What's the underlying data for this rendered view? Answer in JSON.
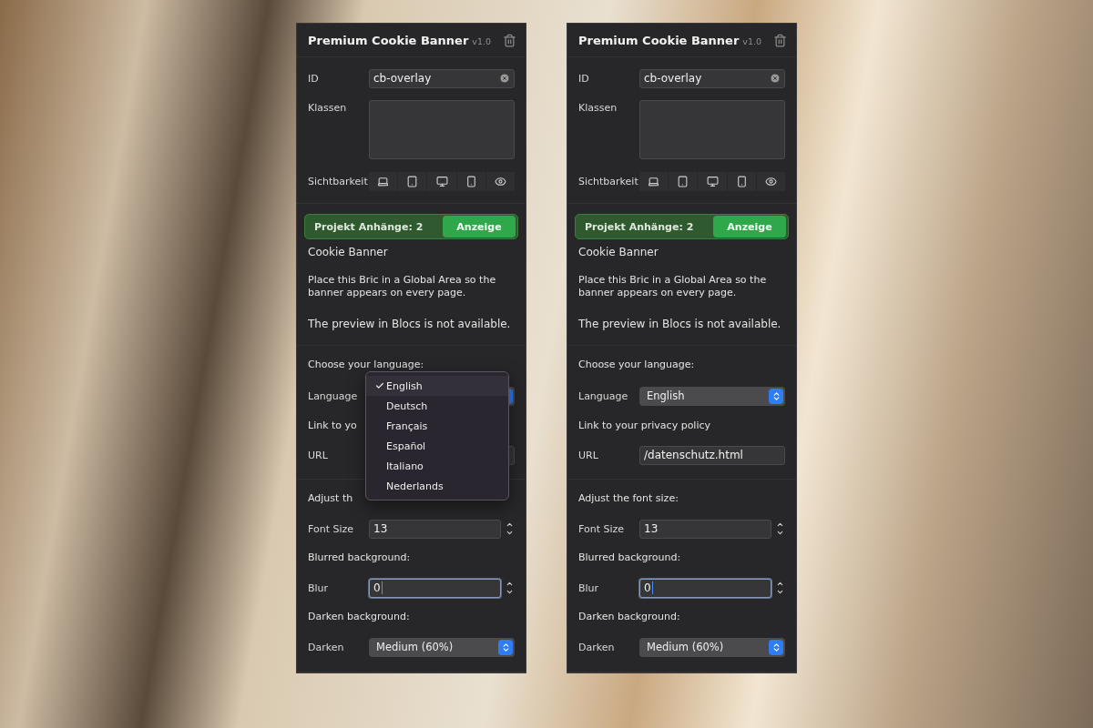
{
  "panels": [
    {
      "title": "Premium Cookie Banner",
      "version": "v1.0",
      "id_label": "ID",
      "id_value": "cb-overlay",
      "classes_label": "Klassen",
      "visibility_label": "Sichtbarkeit",
      "attachments_label": "Projekt Anhänge: 2",
      "attachments_button": "Anzeige",
      "bric_name": "Cookie Banner",
      "description": "Place this Bric in a Global Area so the banner appears on every page.",
      "preview_note": "The preview in Blocs is not available.",
      "language_heading": "Choose your language:",
      "language_label": "Language",
      "link_heading": "Link to yo",
      "url_label": "URL",
      "font_heading": "Adjust th",
      "font_label": "Font Size",
      "font_value": "13",
      "blur_heading": "Blurred background:",
      "blur_label": "Blur",
      "blur_value": "0",
      "blur_focused": true,
      "darken_heading": "Darken background:",
      "darken_label": "Darken",
      "darken_value": "Medium (60%)",
      "language_menu": {
        "options": [
          {
            "label": "English",
            "selected": true
          },
          {
            "label": "Deutsch",
            "selected": false
          },
          {
            "label": "Français",
            "selected": false
          },
          {
            "label": "Español",
            "selected": false
          },
          {
            "label": "Italiano",
            "selected": false
          },
          {
            "label": "Nederlands",
            "selected": false
          }
        ]
      }
    },
    {
      "title": "Premium Cookie Banner",
      "version": "v1.0",
      "id_label": "ID",
      "id_value": "cb-overlay",
      "classes_label": "Klassen",
      "visibility_label": "Sichtbarkeit",
      "attachments_label": "Projekt Anhänge: 2",
      "attachments_button": "Anzeige",
      "bric_name": "Cookie Banner",
      "description": "Place this Bric in a Global Area so the banner appears on every page.",
      "preview_note": "The preview in Blocs is not available.",
      "language_heading": "Choose your language:",
      "language_label": "Language",
      "language_value": "English",
      "link_heading": "Link to your privacy policy",
      "url_label": "URL",
      "url_value": "/datenschutz.html",
      "font_heading": "Adjust the font size:",
      "font_label": "Font Size",
      "font_value": "13",
      "blur_heading": "Blurred background:",
      "blur_label": "Blur",
      "blur_value": "0",
      "blur_focused": true,
      "darken_heading": "Darken background:",
      "darken_label": "Darken",
      "darken_value": "Medium (60%)"
    }
  ]
}
